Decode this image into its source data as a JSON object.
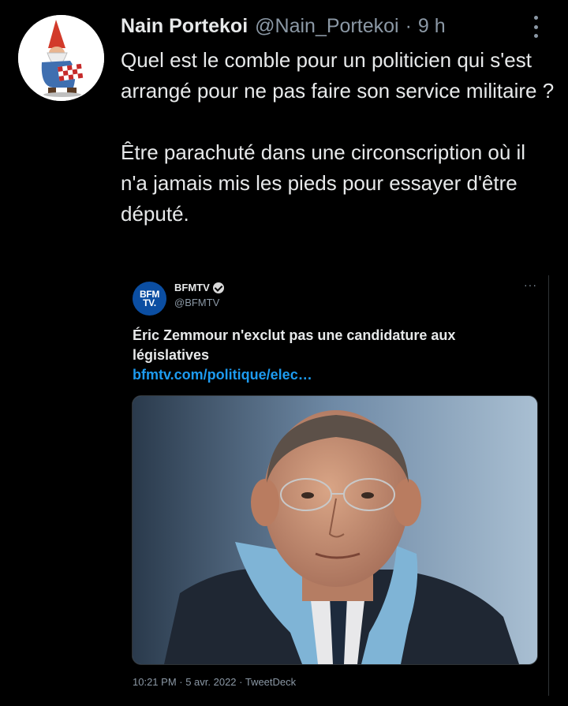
{
  "tweet": {
    "display_name": "Nain Portekoi",
    "handle": "@Nain_Portekoi",
    "separator": "·",
    "time": "9 h",
    "paragraphs": [
      "Quel est le comble pour un politicien qui s'est arrangé pour ne pas faire son service militaire ?",
      "Être parachuté dans une circonscription où il n'a jamais mis les pieds pour essayer d'être député."
    ]
  },
  "embedded_tweet": {
    "avatar_line1": "BFM",
    "avatar_line2": "TV.",
    "name": "BFMTV",
    "handle": "@BFMTV",
    "more": "···",
    "text": "Éric Zemmour n'exclut pas une candidature aux législatives",
    "link": "bfmtv.com/politique/elec…",
    "footer": "10:21 PM · 5 avr. 2022 · TweetDeck"
  },
  "icons": {
    "avatar": "garden-gnome-avatar",
    "more": "vertical-ellipsis-icon",
    "verified": "verified-badge-icon"
  },
  "colors": {
    "background": "#000000",
    "text": "#e7e9ea",
    "secondary": "#8b98a5",
    "link": "#1d9bf0"
  }
}
